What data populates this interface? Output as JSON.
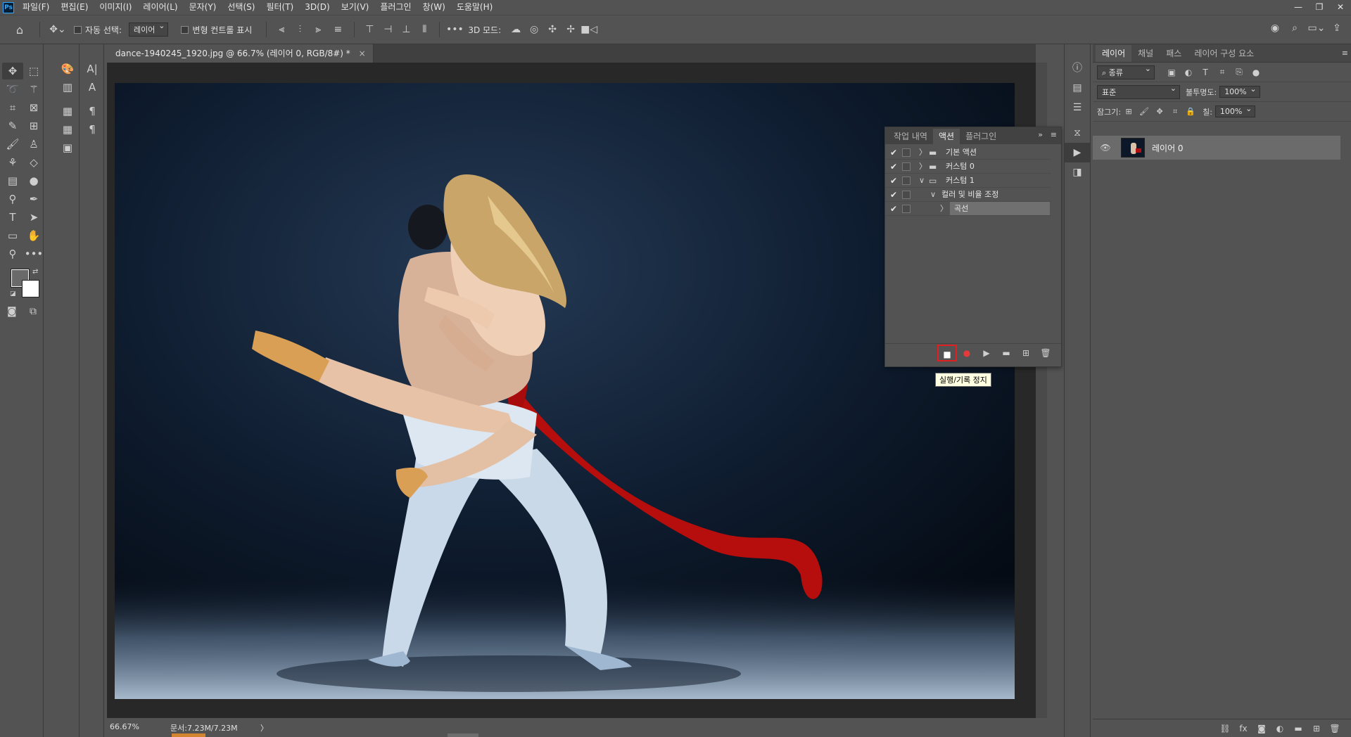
{
  "app": {
    "logo": "Ps"
  },
  "menu": [
    "파일(F)",
    "편집(E)",
    "이미지(I)",
    "레이어(L)",
    "문자(Y)",
    "선택(S)",
    "필터(T)",
    "3D(D)",
    "보기(V)",
    "플러그인",
    "창(W)",
    "도움말(H)"
  ],
  "window_controls": {
    "minimize": "—",
    "restore": "❐",
    "close": "✕"
  },
  "options": {
    "auto_select_label": "자동 선택:",
    "auto_select_value": "레이어",
    "transform_label": "변형 컨트롤 표시",
    "mode_3d_label": "3D 모드:"
  },
  "document": {
    "tab_title": "dance-1940245_1920.jpg @ 66.7% (레이어 0, RGB/8#) *",
    "close": "×",
    "zoom": "66.67%",
    "doc_info": "문서:7.23M/7.23M",
    "status_arrow": "〉"
  },
  "actions_panel": {
    "tabs": [
      "작업 내역",
      "액션",
      "플러그인"
    ],
    "active_tab": "액션",
    "rows": [
      {
        "label": "기본 액션",
        "check": "✔",
        "arrow": "〉",
        "icon": "folder"
      },
      {
        "label": "커스텀 0",
        "check": "✔",
        "arrow": "〉",
        "icon": "folder"
      },
      {
        "label": "커스텀 1",
        "check": "✔",
        "arrow": "∨",
        "icon": "folder-open"
      },
      {
        "label": "컬러 및 비율 조정",
        "check": "✔",
        "arrow": "∨"
      },
      {
        "label": "곡선",
        "check": "✔",
        "arrow": "〉",
        "selected": true
      }
    ],
    "tooltip": "실행/기록 정지"
  },
  "layers_panel": {
    "tabs": [
      "레이어",
      "채널",
      "패스",
      "레이어 구성 요소"
    ],
    "active_tab": "레이어",
    "filter_label": "종류",
    "blend_mode": "표준",
    "opacity_label": "불투명도:",
    "opacity_value": "100%",
    "lock_label": "잠그기:",
    "fill_label": "칠:",
    "fill_value": "100%",
    "layer_name": "레이어 0"
  },
  "colors": {
    "accent": "#31a8ff",
    "highlight_border": "#e02020",
    "canvas_bg": "#282828",
    "panel_bg": "#535353"
  }
}
